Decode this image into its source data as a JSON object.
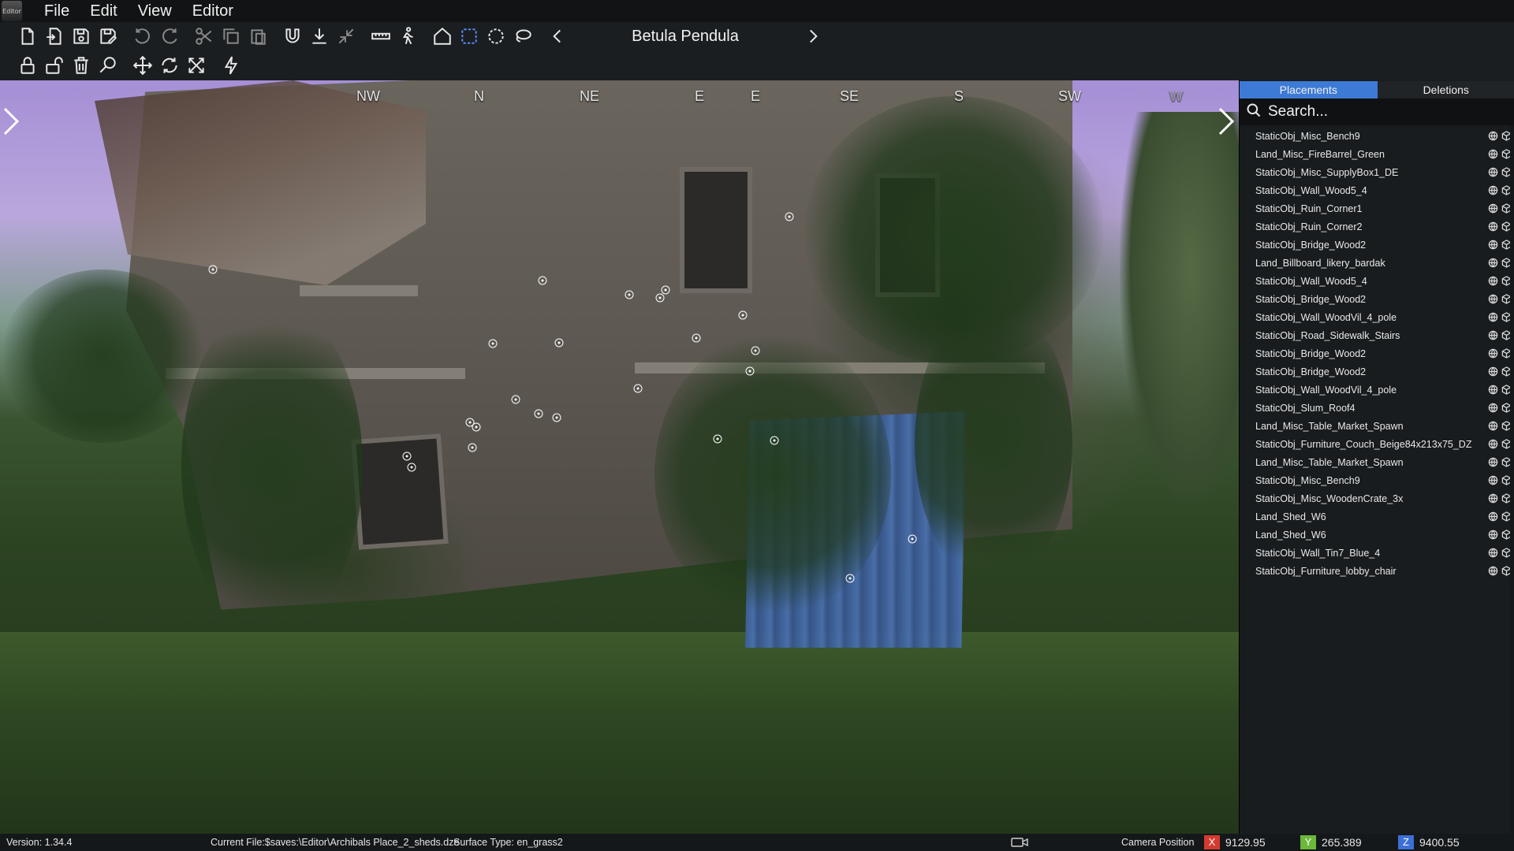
{
  "menu": {
    "logo": "Editor",
    "items": [
      "File",
      "Edit",
      "View",
      "Editor"
    ]
  },
  "toolbar": {
    "row1_icons": [
      "new-file-icon",
      "open-file-icon",
      "save-icon",
      "save-as-icon",
      "undo-icon",
      "redo-icon",
      "cut-icon",
      "copy-icon",
      "paste-icon",
      "magnet-icon",
      "ground-snap-icon",
      "collapse-icon",
      "ruler-icon",
      "walk-icon",
      "house-icon",
      "box-select-icon",
      "circle-select-icon",
      "lasso-select-icon"
    ],
    "row2_icons": [
      "lock-icon",
      "unlock-icon",
      "trash-icon",
      "search-object-icon",
      "move-icon",
      "rotate-icon",
      "scale-icon",
      "lightning-icon"
    ],
    "brush_prev_icon": "chevron-left-icon",
    "brush_next_icon": "chevron-right-icon",
    "brush_name": "Betula Pendula"
  },
  "viewport": {
    "compass": [
      "NW",
      "N",
      "NE",
      "E",
      "E",
      "SE",
      "S",
      "SW",
      "W"
    ]
  },
  "panel": {
    "tabs": [
      "Placements",
      "Deletions"
    ],
    "active_tab": "Placements",
    "search_placeholder": "Search...",
    "items": [
      "StaticObj_Misc_Bench9",
      "Land_Misc_FireBarrel_Green",
      "StaticObj_Misc_SupplyBox1_DE",
      "StaticObj_Wall_Wood5_4",
      "StaticObj_Ruin_Corner1",
      "StaticObj_Ruin_Corner2",
      "StaticObj_Bridge_Wood2",
      "Land_Billboard_likery_bardak",
      "StaticObj_Wall_Wood5_4",
      "StaticObj_Bridge_Wood2",
      "StaticObj_Wall_WoodVil_4_pole",
      "StaticObj_Road_Sidewalk_Stairs",
      "StaticObj_Bridge_Wood2",
      "StaticObj_Bridge_Wood2",
      "StaticObj_Wall_WoodVil_4_pole",
      "StaticObj_Slum_Roof4",
      "Land_Misc_Table_Market_Spawn",
      "StaticObj_Furniture_Couch_Beige84x213x75_DZ",
      "Land_Misc_Table_Market_Spawn",
      "StaticObj_Misc_Bench9",
      "StaticObj_Misc_WoodenCrate_3x",
      "Land_Shed_W6",
      "Land_Shed_W6",
      "StaticObj_Wall_Tin7_Blue_4",
      "StaticObj_Furniture_lobby_chair"
    ]
  },
  "status": {
    "version": "Version:  1.34.4",
    "current_file": "Current File:$saves:\\Editor\\Archibals Place_2_sheds.dze",
    "surface": "Surface Type: en_grass2",
    "camera_label": "Camera Position",
    "x_label": "X",
    "x_value": "9129.95",
    "y_label": "Y",
    "y_value": "265.389",
    "z_label": "Z",
    "z_value": "9400.55"
  },
  "colors": {
    "accent": "#3d7ad6",
    "x_axis": "#d43b2f",
    "y_axis": "#6bb83a",
    "z_axis": "#3d6fd6"
  }
}
